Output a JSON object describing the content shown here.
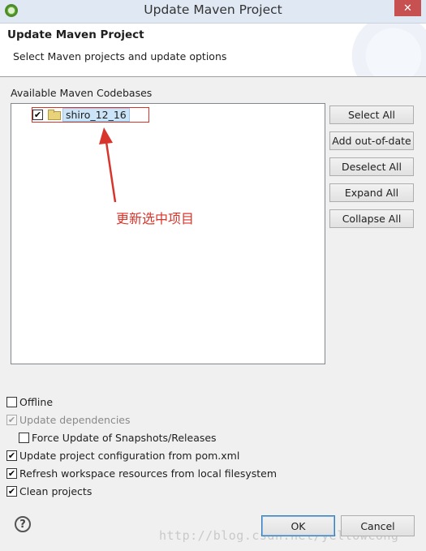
{
  "window": {
    "title": "Update Maven Project",
    "close_glyph": "✕"
  },
  "header": {
    "title": "Update Maven Project",
    "subtitle": "Select Maven projects and update options"
  },
  "codebases": {
    "label": "Available Maven Codebases",
    "items": [
      {
        "label": "shiro_12_16",
        "checked": true
      }
    ]
  },
  "side_buttons": [
    "Select All",
    "Add out-of-date",
    "Deselect All",
    "Expand All",
    "Collapse All"
  ],
  "annotation": {
    "text": "更新选中项目",
    "color": "#d9342b"
  },
  "options": [
    {
      "label": "Offline",
      "checked": false,
      "enabled": true
    },
    {
      "label": "Update dependencies",
      "checked": true,
      "enabled": false
    },
    {
      "label": "Force Update of Snapshots/Releases",
      "checked": false,
      "enabled": true
    },
    {
      "label": "Update project configuration from pom.xml",
      "checked": true,
      "enabled": true
    },
    {
      "label": "Refresh workspace resources from local filesystem",
      "checked": true,
      "enabled": true
    },
    {
      "label": "Clean projects",
      "checked": true,
      "enabled": true
    }
  ],
  "footer": {
    "help_glyph": "?",
    "ok": "OK",
    "cancel": "Cancel"
  },
  "watermark": "http://blog.csdn.net/yellowcong"
}
